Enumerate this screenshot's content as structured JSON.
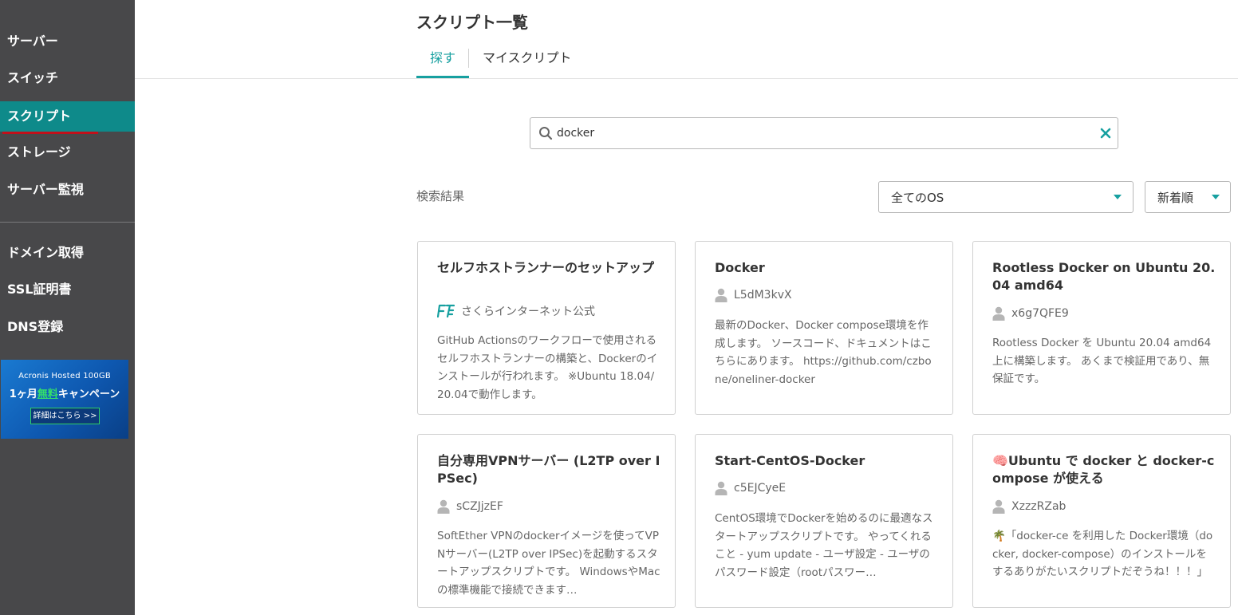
{
  "sidebar": {
    "items": [
      {
        "label": "サーバー"
      },
      {
        "label": "スイッチ"
      },
      {
        "label": "スクリプト"
      },
      {
        "label": "ストレージ"
      },
      {
        "label": "サーバー監視"
      },
      {
        "label": "ドメイン取得"
      },
      {
        "label": "SSL証明書"
      },
      {
        "label": "DNS登録"
      }
    ],
    "banner": {
      "line1": "Acronis Hosted 100GB",
      "line2_pre": "1ヶ月",
      "line2_highlight": "無料",
      "line2_post": "キャンペーン",
      "button_label": "詳細はこちら >>"
    }
  },
  "header": {
    "title": "スクリプト一覧",
    "tabs": [
      {
        "label": "探す"
      },
      {
        "label": "マイスクリプト"
      }
    ]
  },
  "search": {
    "value": "docker"
  },
  "results": {
    "label": "検索結果",
    "os_filter": "全てのOS",
    "sort": "新着順"
  },
  "cards": [
    {
      "title": "セルフホストランナーのセットアップ",
      "author": "さくらインターネット公式",
      "description": "GitHub Actionsのワークフローで使用されるセルフホストランナーの構築と、Dockerのインストールが行われます。 ※Ubuntu 18.04/20.04で動作します。"
    },
    {
      "title": "Docker",
      "author": "L5dM3kvX",
      "description": "最新のDocker、Docker compose環境を作成します。 ソースコード、ドキュメントはこちらにあります。 https://github.com/czbone/oneliner-docker"
    },
    {
      "title": "Rootless Docker on Ubuntu 20.04 amd64",
      "author": "x6g7QFE9",
      "description": "Rootless Docker を Ubuntu 20.04 amd64 上に構築します。 あくまで検証用であり、無保証です。"
    },
    {
      "title": "自分専用VPNサーバー (L2TP over IPSec)",
      "author": "sCZJjzEF",
      "description": "SoftEther VPNのdockerイメージを使ってVPNサーバー(L2TP over IPSec)を起動するスタートアップスクリプトです。 WindowsやMacの標準機能で接続できます…"
    },
    {
      "title": "Start-CentOS-Docker",
      "author": "c5EJCyeE",
      "description": "CentOS環境でDockerを始めるのに最適なスタートアップスクリプトです。 やってくれること - yum update - ユーザ設定 - ユーザのパスワード設定（rootパスワー…"
    },
    {
      "title": "🧠Ubuntu で docker と docker-compose が使える",
      "author": "XzzzRZab",
      "description": "🌴「docker-ce を利用した Docker環境（docker, docker-compose）のインストールをするありがたいスクリプトだぞうね！！！」"
    }
  ]
}
